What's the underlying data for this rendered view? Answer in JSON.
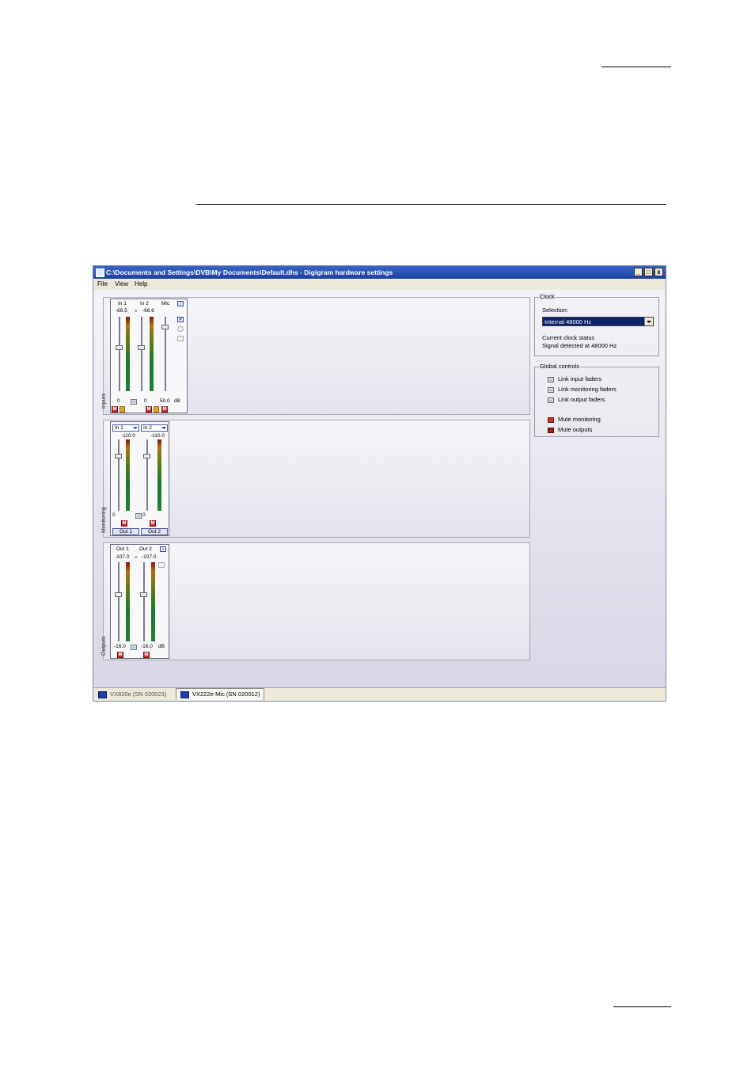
{
  "window": {
    "title": "C:\\Documents and Settings\\DVB\\My Documents\\Default.dhs - Digigram hardware settings",
    "minimize": "_",
    "maximize": "□",
    "close": "x"
  },
  "menu": [
    "File",
    "View",
    "Help"
  ],
  "inputs": {
    "label": "Inputs",
    "channels": [
      {
        "name": "In 1",
        "peak": "-66.5",
        "value": "0"
      },
      {
        "name": "In 2",
        "peak": "-66.6",
        "value": "0"
      },
      {
        "name": "Mic",
        "peak": "",
        "value": "50.0"
      }
    ],
    "unit": "dB",
    "mute": "M"
  },
  "monitoring": {
    "label": "Monitoring",
    "channels": [
      {
        "source": "In 1",
        "peak": "-110.0",
        "value": "0",
        "out": "Out 1"
      },
      {
        "source": "In 2",
        "peak": "-110.0",
        "value": "0",
        "out": "Out 2"
      }
    ],
    "mute": "M"
  },
  "outputs": {
    "label": "Outputs",
    "channels": [
      {
        "name": "Out 1",
        "peak": "-107.0",
        "value": "-16.0"
      },
      {
        "name": "Out 2",
        "peak": "-107.0",
        "value": "-16.0"
      }
    ],
    "unit": "dB",
    "mute": "M"
  },
  "clock": {
    "legend": "Clock",
    "selection_label": "Selection:",
    "selection_value": "Internal 48000 Hz",
    "status_label": "Current clock status",
    "status_value": "Signal detected at 48000 Hz"
  },
  "global_controls": {
    "legend": "Global controls",
    "items": [
      "Link input faders",
      "Link monitoring faders",
      "Link output faders",
      "Mute monitoring",
      "Mute outputs"
    ]
  },
  "tabs": [
    {
      "label": "VX820e (SN 020023)",
      "active": false
    },
    {
      "label": "VX222e-Mic (SN 020012)",
      "active": true
    }
  ],
  "colors": {
    "titlebar": "#1c3f9e",
    "mute": "#c83030",
    "meter_green": "#1f8030"
  }
}
